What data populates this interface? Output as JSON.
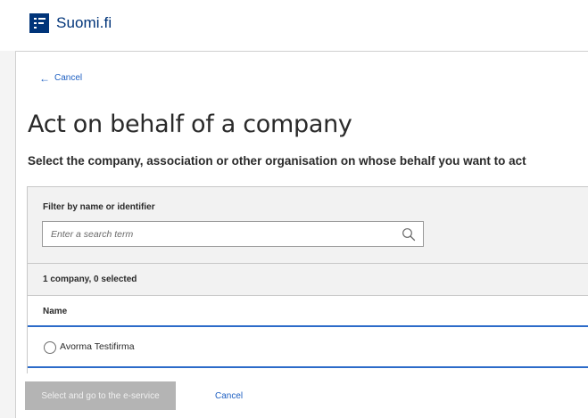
{
  "header": {
    "logo_text": "Suomi.fi",
    "brand_color": "#003479"
  },
  "nav": {
    "back_label": "Cancel"
  },
  "page": {
    "title": "Act on behalf of a company",
    "subtitle": "Select the company, association or other organisation on whose behalf you want to act"
  },
  "filter": {
    "label": "Filter by name or identifier",
    "placeholder": "Enter a search term",
    "value": ""
  },
  "results": {
    "count_text": "1 company, 0 selected",
    "column_header": "Name",
    "companies": [
      {
        "name": "Avorma Testifirma",
        "selected": false
      }
    ]
  },
  "actions": {
    "select_label": "Select and go to the e-service",
    "select_enabled": false,
    "cancel_label": "Cancel"
  },
  "colors": {
    "accent": "#2c6bc9",
    "link": "#1d5fc2",
    "disabled_button": "#b4b4b4"
  }
}
